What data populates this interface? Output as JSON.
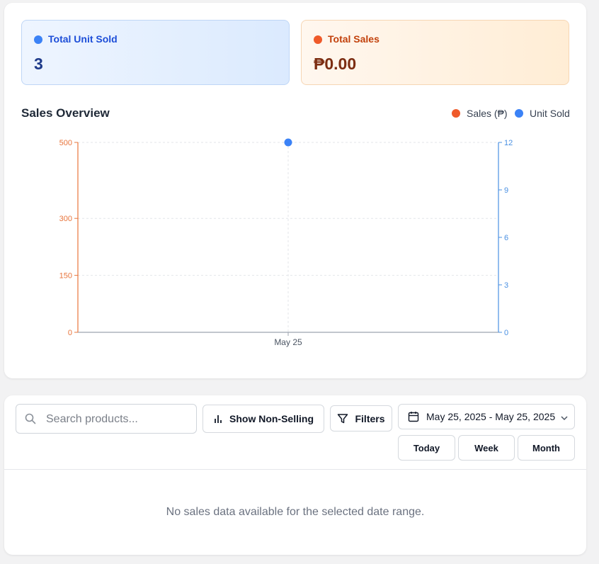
{
  "stats": {
    "units": {
      "label": "Total Unit Sold",
      "value": "3",
      "dot_color": "#3b82f6",
      "label_color": "#1d4ed8",
      "value_color": "#1e3a8a"
    },
    "sales": {
      "label": "Total Sales",
      "value": "₱0.00",
      "dot_color": "#ef5a2a",
      "label_color": "#c2410c",
      "value_color": "#7c2d12"
    }
  },
  "chart": {
    "title": "Sales Overview",
    "legend": [
      {
        "name": "Sales (₱)",
        "color": "#ef5a2a"
      },
      {
        "name": "Unit Sold",
        "color": "#3b82f6"
      }
    ]
  },
  "chart_data": {
    "type": "line",
    "title": "Sales Overview",
    "x": [
      "May 25"
    ],
    "series": [
      {
        "name": "Sales (₱)",
        "axis": "left",
        "values": [
          0
        ],
        "color": "#ef5a2a"
      },
      {
        "name": "Unit Sold",
        "axis": "right",
        "values": [
          12
        ],
        "color": "#3b82f6"
      }
    ],
    "y_left": {
      "ticks": [
        0,
        150,
        300,
        500
      ],
      "ylim": [
        0,
        500
      ],
      "color": "#e8743b"
    },
    "y_right": {
      "ticks": [
        0,
        3,
        6,
        9,
        12
      ],
      "ylim": [
        0,
        12
      ],
      "color": "#4a90e2"
    },
    "grid": true,
    "legend": "top-right"
  },
  "toolbar": {
    "search_placeholder": "Search products...",
    "non_selling_label": "Show Non-Selling",
    "filters_label": "Filters",
    "date_range": "May 25, 2025 - May 25, 2025",
    "today_label": "Today",
    "week_label": "Week",
    "month_label": "Month"
  },
  "empty_message": "No sales data available for the selected date range."
}
